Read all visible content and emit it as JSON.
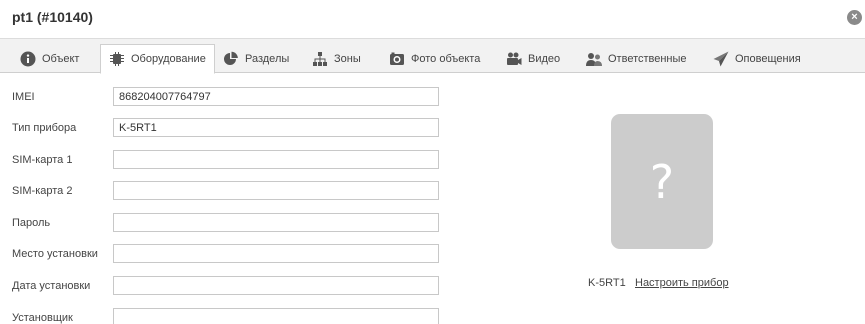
{
  "header": {
    "title": "pt1 (#10140)",
    "close_glyph": "×"
  },
  "tabs": [
    {
      "label": "Объект",
      "icon": "info-icon",
      "active": false
    },
    {
      "label": "Оборудование",
      "icon": "chip-icon",
      "active": true
    },
    {
      "label": "Разделы",
      "icon": "pie-chart-icon",
      "active": false
    },
    {
      "label": "Зоны",
      "icon": "hierarchy-icon",
      "active": false
    },
    {
      "label": "Фото объекта",
      "icon": "camera-icon",
      "active": false
    },
    {
      "label": "Видео",
      "icon": "video-camera-icon",
      "active": false
    },
    {
      "label": "Ответственные",
      "icon": "users-icon",
      "active": false
    },
    {
      "label": "Оповещения",
      "icon": "send-icon",
      "active": false
    }
  ],
  "form": {
    "fields": [
      {
        "label": "IMEI",
        "value": "868204007764797"
      },
      {
        "label": "Тип прибора",
        "value": "K-5RT1"
      },
      {
        "label": "SIM-карта 1",
        "value": ""
      },
      {
        "label": "SIM-карта 2",
        "value": ""
      },
      {
        "label": "Пароль",
        "value": ""
      },
      {
        "label": "Место установки",
        "value": ""
      },
      {
        "label": "Дата установки",
        "value": ""
      },
      {
        "label": "Установщик",
        "value": ""
      }
    ]
  },
  "device": {
    "image_glyph": "?",
    "model": "K-5RT1",
    "configure_link": "Настроить прибор"
  },
  "colors": {
    "tabbar_bg": "#f2f2f2",
    "placeholder_bg": "#cccccc",
    "icon_gray": "#666666"
  }
}
